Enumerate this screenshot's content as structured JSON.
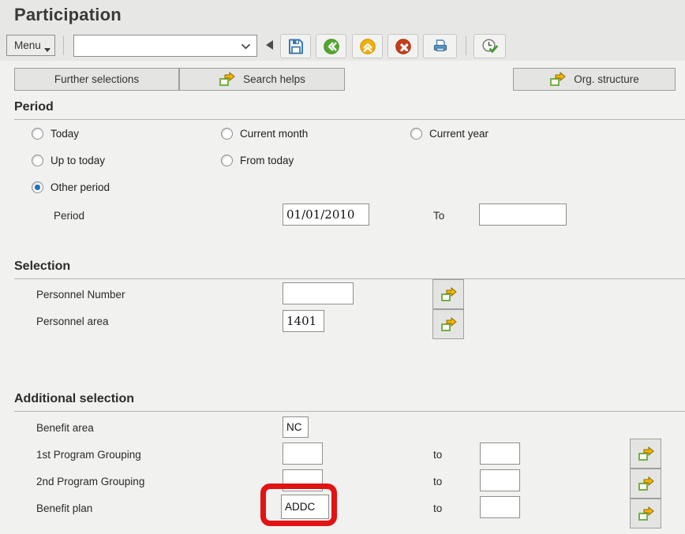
{
  "window": {
    "title": "Participation"
  },
  "toolbar": {
    "menu_label": "Menu",
    "command_field": {
      "value": "",
      "placeholder": ""
    },
    "icon_buttons": [
      "save",
      "back",
      "exit",
      "cancel",
      "print",
      "check"
    ]
  },
  "actions": {
    "further_selections": "Further selections",
    "search_helps": "Search helps",
    "org_structure": "Org. structure"
  },
  "period": {
    "title": "Period",
    "radios": [
      {
        "label": "Today",
        "selected": false
      },
      {
        "label": "Current month",
        "selected": false
      },
      {
        "label": "Current year",
        "selected": false
      },
      {
        "label": "Up to today",
        "selected": false
      },
      {
        "label": "From today",
        "selected": false
      },
      {
        "label": "Other period",
        "selected": true
      }
    ],
    "field_label": "Period",
    "from_value": "01/01/2010",
    "to_label": "To",
    "to_value": ""
  },
  "selection": {
    "title": "Selection",
    "rows": [
      {
        "label": "Personnel Number",
        "value": ""
      },
      {
        "label": "Personnel area",
        "value": "1401"
      }
    ]
  },
  "additional": {
    "title": "Additional selection",
    "benefit_area_label": "Benefit area",
    "benefit_area_value": "NC",
    "rows": [
      {
        "label": "1st Program Grouping",
        "from": "",
        "to_label": "to",
        "to": ""
      },
      {
        "label": "2nd Program Grouping",
        "from": "",
        "to_label": "to",
        "to": ""
      },
      {
        "label": "Benefit plan",
        "from": "ADDC",
        "to_label": "to",
        "to": "",
        "highlighted": true
      }
    ]
  },
  "colors": {
    "accent_blue": "#3c79ae",
    "accent_green": "#55a82f",
    "accent_orange": "#f3ae0b",
    "accent_red": "#c63d1d",
    "arrow_yellow": "#f7b500",
    "box_green": "#76b043",
    "check_green": "#3da22f",
    "radio_selected": "#1f6fc4",
    "highlight_ring": "#e21313"
  }
}
